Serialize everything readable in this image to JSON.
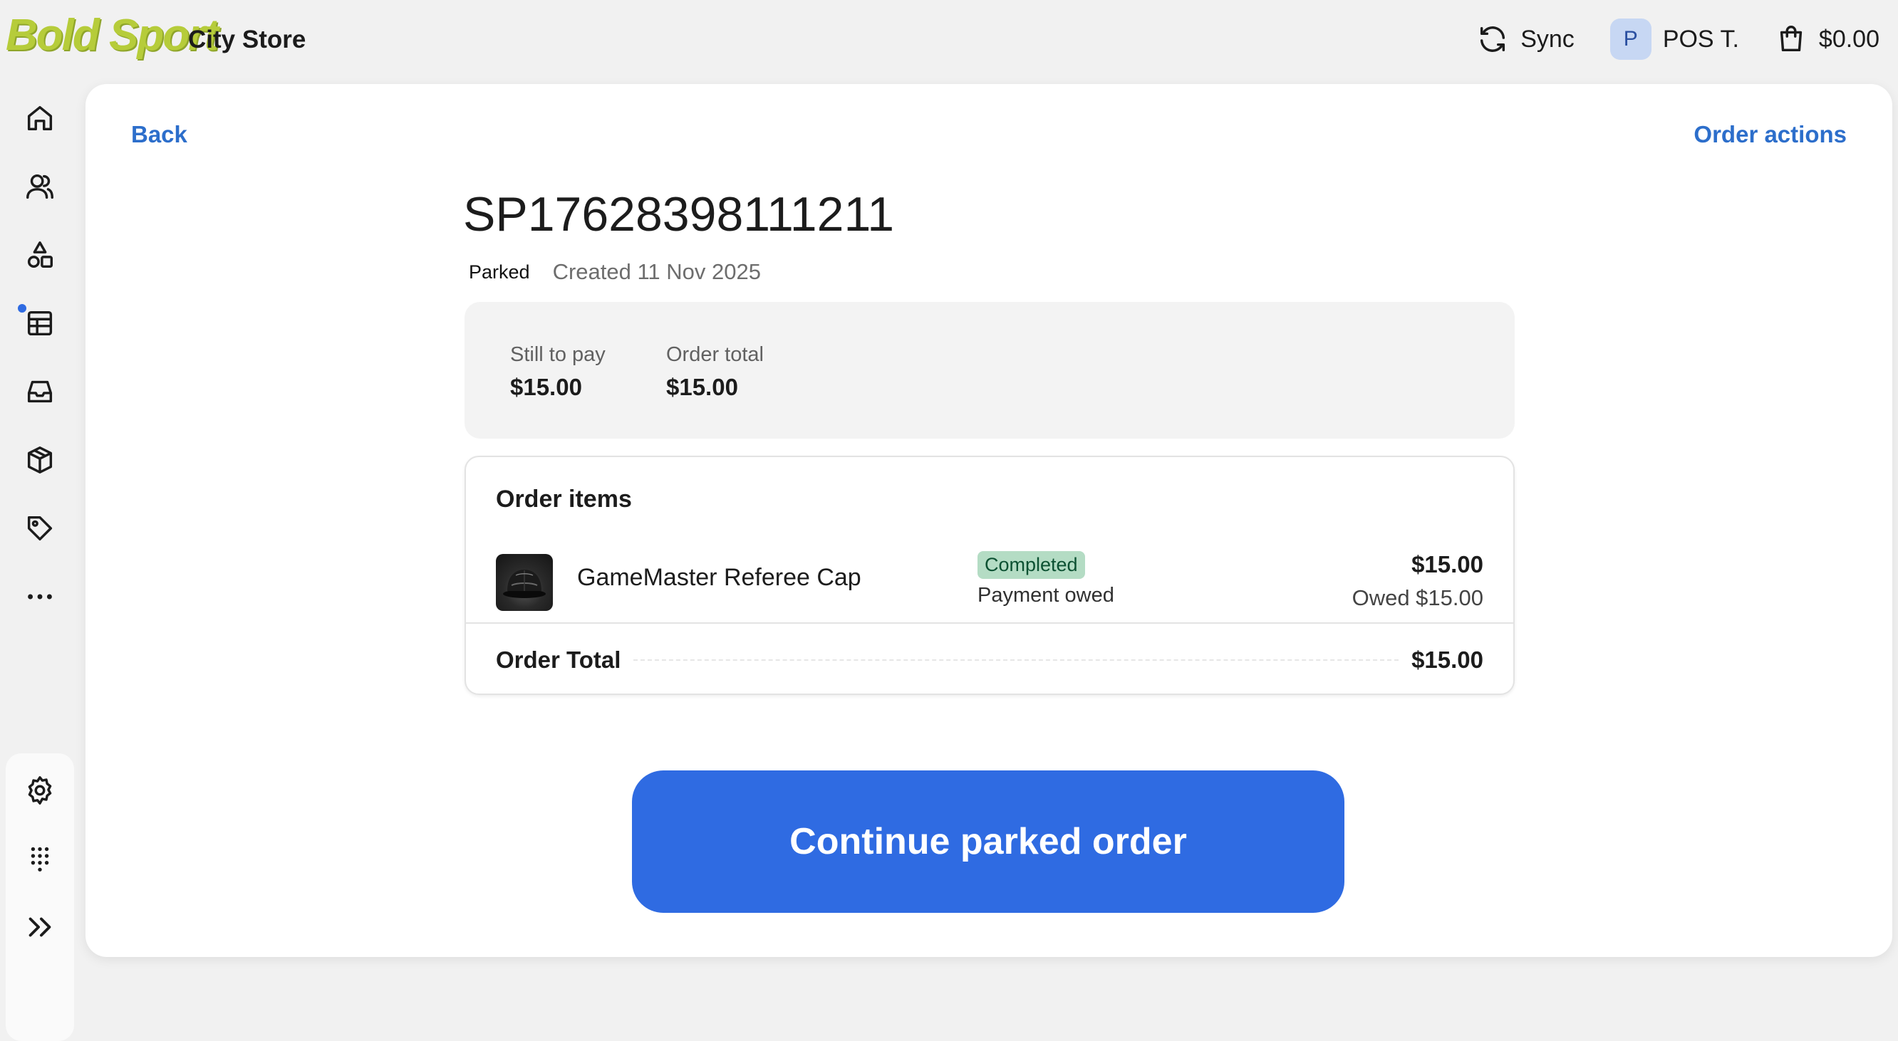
{
  "header": {
    "brand": "Bold Sport",
    "store_name": "City Store",
    "sync_label": "Sync",
    "user_initial": "P",
    "user_name": "POS T.",
    "cart_total": "$0.00"
  },
  "sidebar": {
    "items": [
      {
        "icon": "home-icon"
      },
      {
        "icon": "customers-icon"
      },
      {
        "icon": "products-icon"
      },
      {
        "icon": "orders-icon",
        "has_notification": true
      },
      {
        "icon": "inbox-icon"
      },
      {
        "icon": "inventory-icon"
      },
      {
        "icon": "discounts-icon"
      },
      {
        "icon": "more-icon"
      }
    ],
    "bottom": [
      {
        "icon": "settings-icon"
      },
      {
        "icon": "keypad-icon"
      },
      {
        "icon": "expand-icon"
      }
    ]
  },
  "nav": {
    "back_label": "Back",
    "order_actions_label": "Order actions"
  },
  "order": {
    "id": "SP17628398111211",
    "status": "Parked",
    "created": "Created 11 Nov 2025",
    "still_to_pay_label": "Still to pay",
    "still_to_pay_value": "$15.00",
    "order_total_label": "Order total",
    "order_total_value": "$15.00"
  },
  "items_card": {
    "title": "Order items",
    "items": [
      {
        "name": "GameMaster Referee Cap",
        "fulfillment_status": "Completed",
        "payment_status": "Payment owed",
        "price": "$15.00",
        "owed": "Owed $15.00"
      }
    ],
    "total_label": "Order Total",
    "total_value": "$15.00"
  },
  "primary_action": {
    "label": "Continue parked order"
  },
  "colors": {
    "accent": "#2f6be2",
    "link": "#2c6ecb",
    "brand": "#b6cc3a",
    "success_badge_bg": "#b4dcc4",
    "success_badge_text": "#0c5132"
  }
}
